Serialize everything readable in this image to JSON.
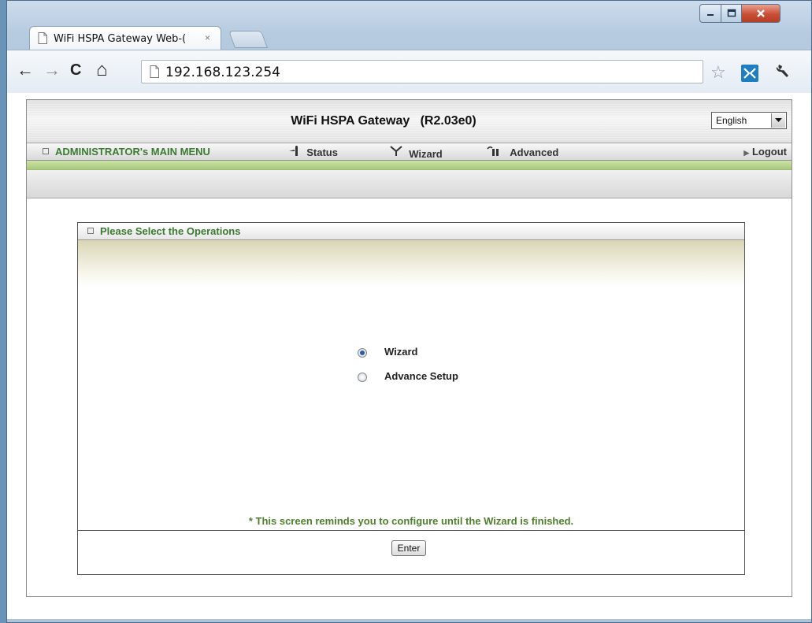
{
  "browser": {
    "tab_title": "WiFi HSPA Gateway Web-(",
    "tab_close": "×",
    "url": "192.168.123.254",
    "nav": {
      "back": "←",
      "forward": "→",
      "reload": "C",
      "home": "⌂"
    }
  },
  "page": {
    "title": "WiFi HSPA Gateway",
    "version": "(R2.03e0)",
    "language": {
      "selected": "English"
    },
    "menu": {
      "admin": "ADMINISTRATOR's MAIN MENU",
      "status": "Status",
      "wizard": "Wizard",
      "advanced": "Advanced",
      "logout": "Logout"
    },
    "panel": {
      "title": "Please Select the Operations",
      "options": [
        {
          "label": "Wizard",
          "checked": true
        },
        {
          "label": "Advance Setup",
          "checked": false
        }
      ],
      "note": "* This screen reminds you to configure until the Wizard is finished.",
      "enter_label": "Enter"
    }
  },
  "colors": {
    "menu_green": "#3b7a31",
    "note_green": "#4f7f2c",
    "green_bar": "#b8d48e"
  }
}
